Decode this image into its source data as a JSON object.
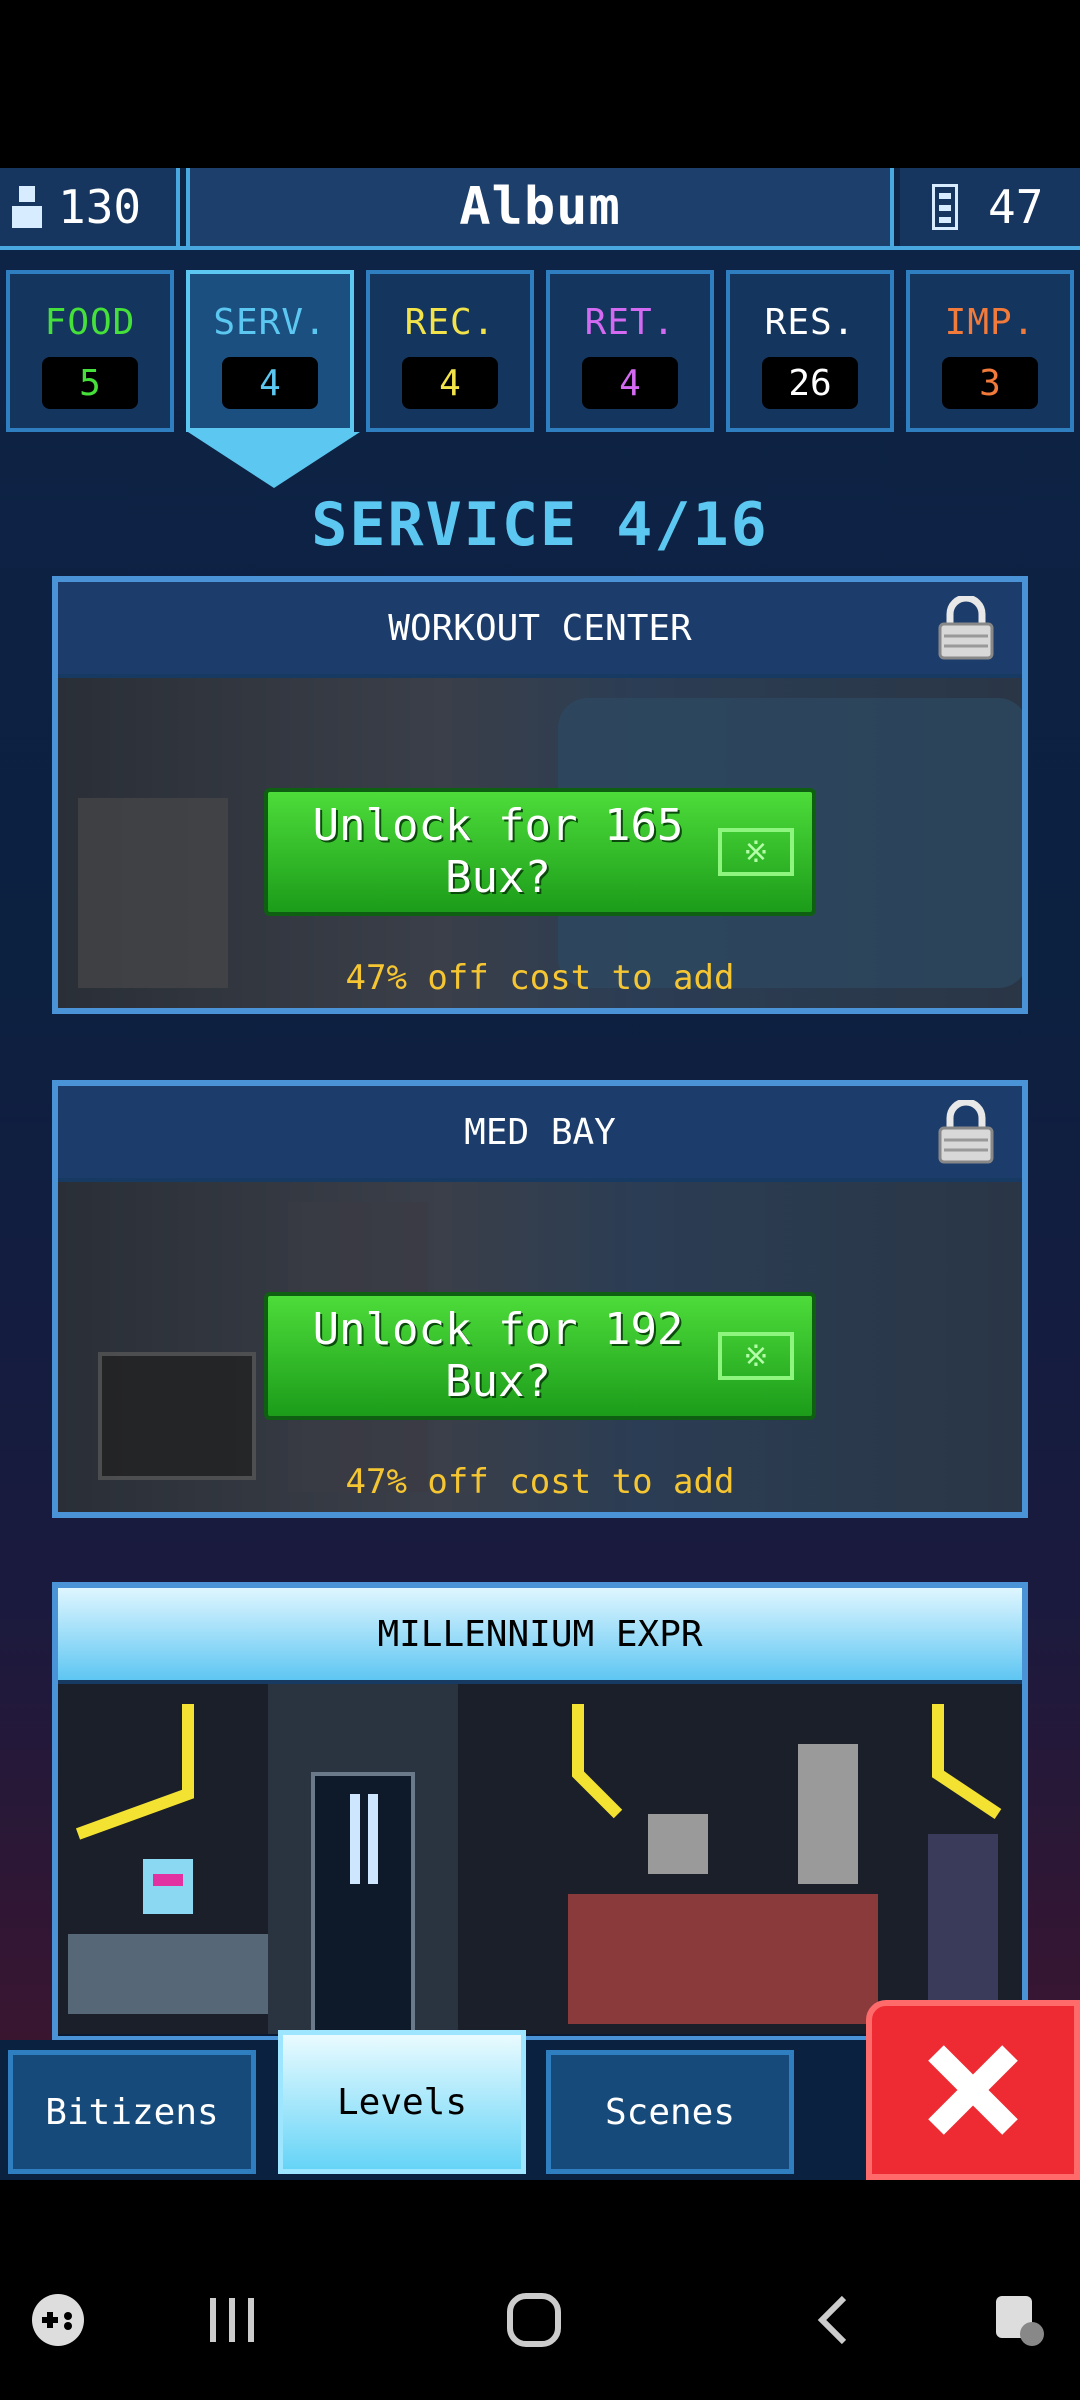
{
  "header": {
    "population": "130",
    "title": "Album",
    "floors": "47"
  },
  "tabs": [
    {
      "label": "FOOD",
      "count": "5",
      "color": "#46e03a"
    },
    {
      "label": "SERV.",
      "count": "4",
      "color": "#5cc8f2"
    },
    {
      "label": "REC.",
      "count": "4",
      "color": "#f2e34a"
    },
    {
      "label": "RET.",
      "count": "4",
      "color": "#d46af2"
    },
    {
      "label": "RES.",
      "count": "26",
      "color": "#ffffff"
    },
    {
      "label": "IMP.",
      "count": "3",
      "color": "#f27a3a"
    }
  ],
  "section_title": "SERVICE 4/16",
  "cards": [
    {
      "name": "WORKOUT CENTER",
      "unlock_text": "Unlock for 165 Bux?",
      "discount": "47% off cost to add"
    },
    {
      "name": "MED BAY",
      "unlock_text": "Unlock for 192 Bux?",
      "discount": "47% off cost to add"
    },
    {
      "name": "MILLENNIUM EXPR"
    }
  ],
  "bottom_tabs": [
    "Bitizens",
    "Levels",
    "Scenes"
  ],
  "bux_symbol": "※",
  "accent_color": "#5cc8f2"
}
